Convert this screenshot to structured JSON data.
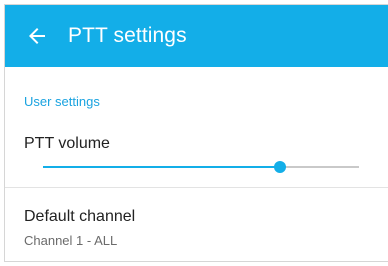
{
  "app_bar": {
    "title": "PTT settings",
    "back_icon": "arrow-left-icon",
    "color": "#13aee8"
  },
  "settings": {
    "section_header": "User settings",
    "ptt_volume": {
      "label": "PTT volume",
      "value_fraction": 0.75
    },
    "default_channel": {
      "label": "Default channel",
      "value": "Channel 1 - ALL"
    }
  }
}
